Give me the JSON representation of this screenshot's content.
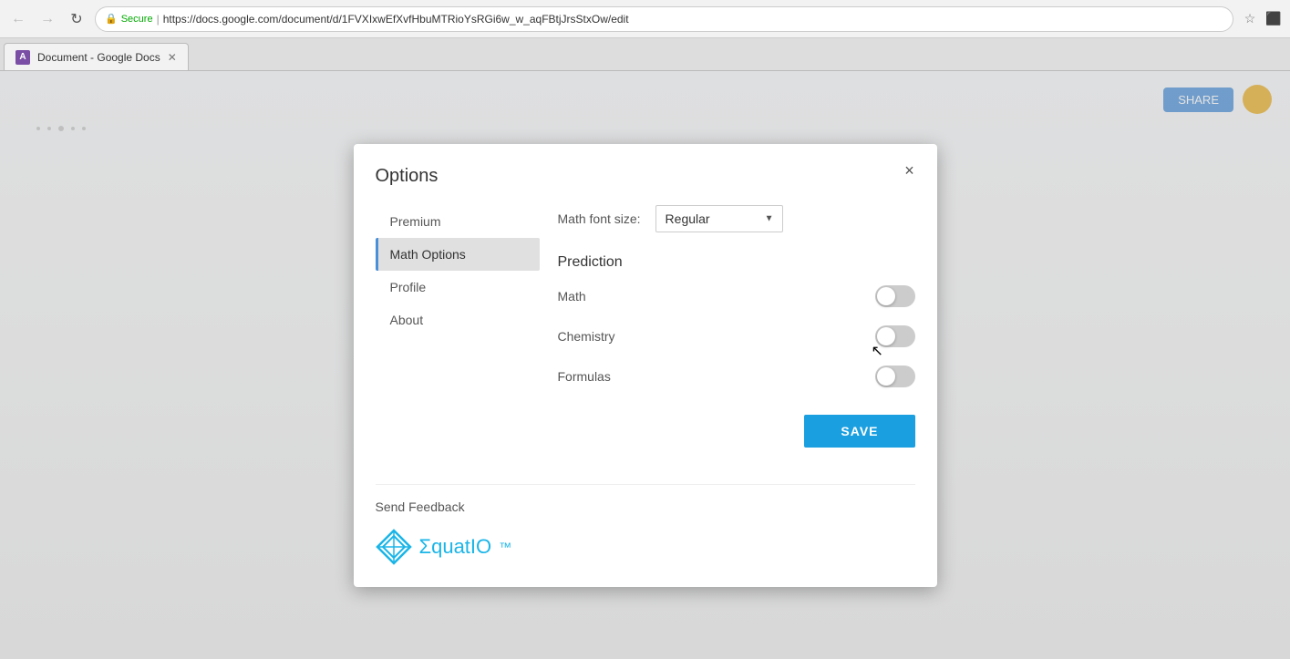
{
  "browser": {
    "url": "https://docs.google.com/document/d/1FVXIxwEfXvfHbuMTRioYsRGi6w_w_aqFBtjJrsStxOw/edit",
    "secure_label": "Secure",
    "tab_title": "Document - Google Docs"
  },
  "topbar": {
    "share_label": "SHARE",
    "tab_favicon_label": "A"
  },
  "dialog": {
    "title": "Options",
    "close_label": "×",
    "nav": {
      "items": [
        {
          "label": "Premium",
          "active": false
        },
        {
          "label": "Math Options",
          "active": true
        },
        {
          "label": "Profile",
          "active": false
        },
        {
          "label": "About",
          "active": false
        }
      ]
    },
    "content": {
      "font_size_label": "Math font size:",
      "font_size_value": "Regular",
      "prediction_title": "Prediction",
      "toggles": [
        {
          "label": "Math",
          "on": false
        },
        {
          "label": "Chemistry",
          "on": false
        },
        {
          "label": "Formulas",
          "on": false
        }
      ]
    },
    "save_label": "SAVE",
    "footer": {
      "feedback_label": "Send Feedback",
      "logo_text": "ΣquatIO"
    }
  }
}
